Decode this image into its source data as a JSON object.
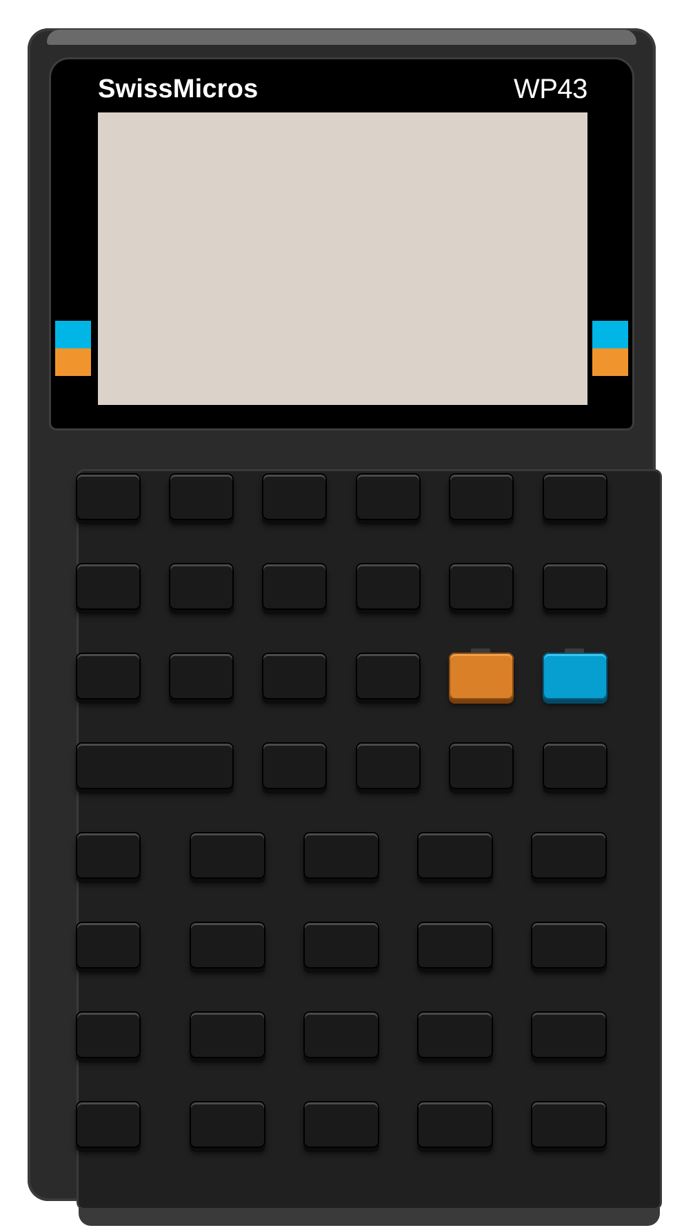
{
  "device": {
    "brand": "SwissMicros",
    "model": "WP43"
  },
  "colors": {
    "shell": "#2b2b2b",
    "lcd": "#dbd3ca",
    "f_shift": "#f0952d",
    "g_shift": "#00b6e6"
  },
  "keys": [
    {
      "row": 1,
      "col": 1,
      "color": "black"
    },
    {
      "row": 1,
      "col": 2,
      "color": "black"
    },
    {
      "row": 1,
      "col": 3,
      "color": "black"
    },
    {
      "row": 1,
      "col": 4,
      "color": "black"
    },
    {
      "row": 1,
      "col": 5,
      "color": "black"
    },
    {
      "row": 1,
      "col": 6,
      "color": "black"
    },
    {
      "row": 2,
      "col": 1,
      "color": "black"
    },
    {
      "row": 2,
      "col": 2,
      "color": "black"
    },
    {
      "row": 2,
      "col": 3,
      "color": "black"
    },
    {
      "row": 2,
      "col": 4,
      "color": "black"
    },
    {
      "row": 2,
      "col": 5,
      "color": "black"
    },
    {
      "row": 2,
      "col": 6,
      "color": "black"
    },
    {
      "row": 3,
      "col": 1,
      "color": "black"
    },
    {
      "row": 3,
      "col": 2,
      "color": "black"
    },
    {
      "row": 3,
      "col": 3,
      "color": "black"
    },
    {
      "row": 3,
      "col": 4,
      "color": "black"
    },
    {
      "row": 3,
      "col": 5,
      "color": "orange"
    },
    {
      "row": 3,
      "col": 6,
      "color": "blue"
    },
    {
      "row": 4,
      "col": 1,
      "color": "black",
      "wide": true
    },
    {
      "row": 4,
      "col": 3,
      "color": "black"
    },
    {
      "row": 4,
      "col": 4,
      "color": "black"
    },
    {
      "row": 4,
      "col": 5,
      "color": "black"
    },
    {
      "row": 4,
      "col": 6,
      "color": "black"
    },
    {
      "row": 5,
      "col": 1,
      "color": "black"
    },
    {
      "row": 5,
      "col": 2,
      "color": "black"
    },
    {
      "row": 5,
      "col": 3,
      "color": "black"
    },
    {
      "row": 5,
      "col": 4,
      "color": "black"
    },
    {
      "row": 5,
      "col": 5,
      "color": "black"
    },
    {
      "row": 6,
      "col": 1,
      "color": "black"
    },
    {
      "row": 6,
      "col": 2,
      "color": "black"
    },
    {
      "row": 6,
      "col": 3,
      "color": "black"
    },
    {
      "row": 6,
      "col": 4,
      "color": "black"
    },
    {
      "row": 6,
      "col": 5,
      "color": "black"
    },
    {
      "row": 7,
      "col": 1,
      "color": "black"
    },
    {
      "row": 7,
      "col": 2,
      "color": "black"
    },
    {
      "row": 7,
      "col": 3,
      "color": "black"
    },
    {
      "row": 7,
      "col": 4,
      "color": "black"
    },
    {
      "row": 7,
      "col": 5,
      "color": "black"
    },
    {
      "row": 8,
      "col": 1,
      "color": "black"
    },
    {
      "row": 8,
      "col": 2,
      "color": "black"
    },
    {
      "row": 8,
      "col": 3,
      "color": "black"
    },
    {
      "row": 8,
      "col": 4,
      "color": "black"
    },
    {
      "row": 8,
      "col": 5,
      "color": "black"
    }
  ]
}
